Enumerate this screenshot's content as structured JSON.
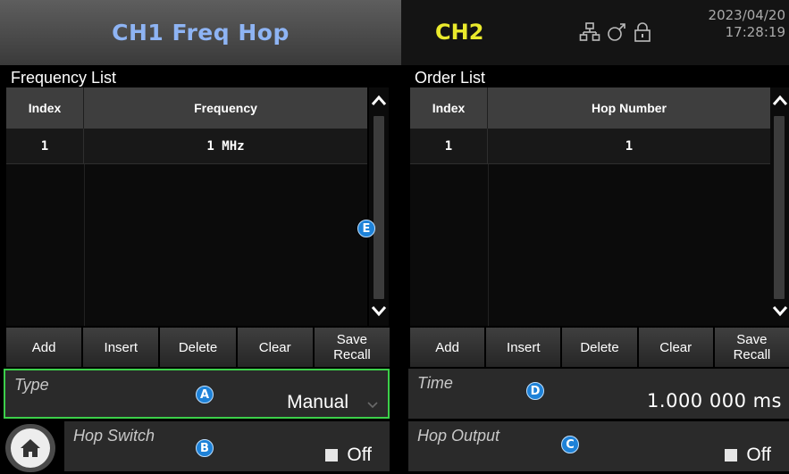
{
  "header": {
    "ch1_title": "CH1 Freq Hop",
    "ch2_title": "CH2",
    "date": "2023/04/20",
    "time": "17:28:19",
    "icons": [
      "network-icon",
      "usb-icon",
      "lock-icon"
    ]
  },
  "frequency_list": {
    "title": "Frequency List",
    "columns": [
      "Index",
      "Frequency"
    ],
    "rows": [
      [
        "1",
        "1 MHz"
      ]
    ]
  },
  "order_list": {
    "title": "Order List",
    "columns": [
      "Index",
      "Hop Number"
    ],
    "rows": [
      [
        "1",
        "1"
      ]
    ]
  },
  "left_buttons": {
    "add": "Add",
    "insert": "Insert",
    "delete": "Delete",
    "clear": "Clear",
    "save_recall": "Save\nRecall"
  },
  "right_buttons": {
    "add": "Add",
    "insert": "Insert",
    "delete": "Delete",
    "clear": "Clear",
    "save_recall": "Save\nRecall"
  },
  "type": {
    "label": "Type",
    "value": "Manual"
  },
  "time_param": {
    "label": "Time",
    "value": "1.000 000 ms"
  },
  "hop_switch": {
    "label": "Hop Switch",
    "value": "Off"
  },
  "hop_output": {
    "label": "Hop Output",
    "value": "Off"
  },
  "markers": {
    "a": "A",
    "b": "B",
    "c": "C",
    "d": "D",
    "e": "E"
  },
  "colors": {
    "ch1_title": "#8eb4f4",
    "ch2_title": "#eaea2c",
    "focus_border": "#3ccf4a",
    "marker": "#1e82d8"
  }
}
